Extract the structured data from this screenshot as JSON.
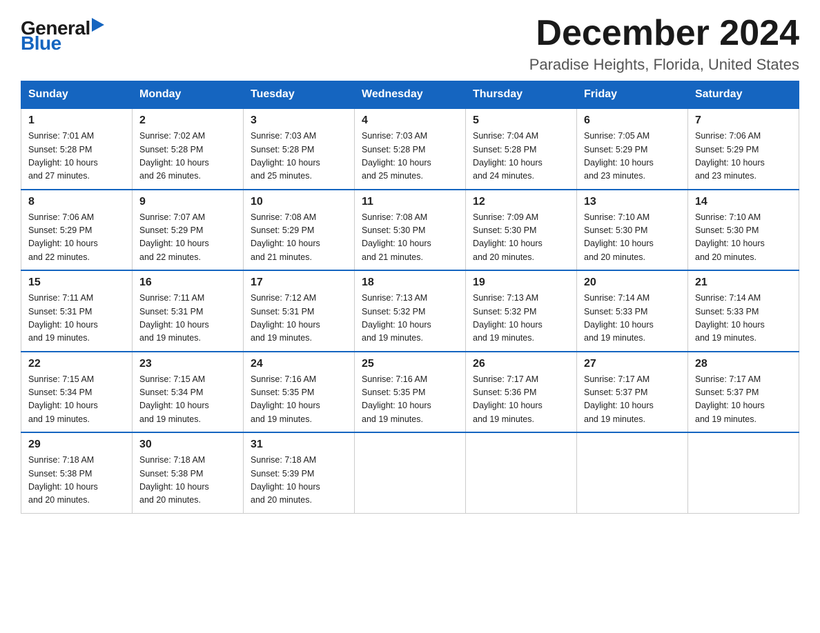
{
  "logo": {
    "general": "General",
    "blue": "Blue"
  },
  "title": {
    "month": "December 2024",
    "location": "Paradise Heights, Florida, United States"
  },
  "weekdays": [
    "Sunday",
    "Monday",
    "Tuesday",
    "Wednesday",
    "Thursday",
    "Friday",
    "Saturday"
  ],
  "weeks": [
    [
      {
        "day": "1",
        "sunrise": "7:01 AM",
        "sunset": "5:28 PM",
        "daylight": "10 hours and 27 minutes."
      },
      {
        "day": "2",
        "sunrise": "7:02 AM",
        "sunset": "5:28 PM",
        "daylight": "10 hours and 26 minutes."
      },
      {
        "day": "3",
        "sunrise": "7:03 AM",
        "sunset": "5:28 PM",
        "daylight": "10 hours and 25 minutes."
      },
      {
        "day": "4",
        "sunrise": "7:03 AM",
        "sunset": "5:28 PM",
        "daylight": "10 hours and 25 minutes."
      },
      {
        "day": "5",
        "sunrise": "7:04 AM",
        "sunset": "5:28 PM",
        "daylight": "10 hours and 24 minutes."
      },
      {
        "day": "6",
        "sunrise": "7:05 AM",
        "sunset": "5:29 PM",
        "daylight": "10 hours and 23 minutes."
      },
      {
        "day": "7",
        "sunrise": "7:06 AM",
        "sunset": "5:29 PM",
        "daylight": "10 hours and 23 minutes."
      }
    ],
    [
      {
        "day": "8",
        "sunrise": "7:06 AM",
        "sunset": "5:29 PM",
        "daylight": "10 hours and 22 minutes."
      },
      {
        "day": "9",
        "sunrise": "7:07 AM",
        "sunset": "5:29 PM",
        "daylight": "10 hours and 22 minutes."
      },
      {
        "day": "10",
        "sunrise": "7:08 AM",
        "sunset": "5:29 PM",
        "daylight": "10 hours and 21 minutes."
      },
      {
        "day": "11",
        "sunrise": "7:08 AM",
        "sunset": "5:30 PM",
        "daylight": "10 hours and 21 minutes."
      },
      {
        "day": "12",
        "sunrise": "7:09 AM",
        "sunset": "5:30 PM",
        "daylight": "10 hours and 20 minutes."
      },
      {
        "day": "13",
        "sunrise": "7:10 AM",
        "sunset": "5:30 PM",
        "daylight": "10 hours and 20 minutes."
      },
      {
        "day": "14",
        "sunrise": "7:10 AM",
        "sunset": "5:30 PM",
        "daylight": "10 hours and 20 minutes."
      }
    ],
    [
      {
        "day": "15",
        "sunrise": "7:11 AM",
        "sunset": "5:31 PM",
        "daylight": "10 hours and 19 minutes."
      },
      {
        "day": "16",
        "sunrise": "7:11 AM",
        "sunset": "5:31 PM",
        "daylight": "10 hours and 19 minutes."
      },
      {
        "day": "17",
        "sunrise": "7:12 AM",
        "sunset": "5:31 PM",
        "daylight": "10 hours and 19 minutes."
      },
      {
        "day": "18",
        "sunrise": "7:13 AM",
        "sunset": "5:32 PM",
        "daylight": "10 hours and 19 minutes."
      },
      {
        "day": "19",
        "sunrise": "7:13 AM",
        "sunset": "5:32 PM",
        "daylight": "10 hours and 19 minutes."
      },
      {
        "day": "20",
        "sunrise": "7:14 AM",
        "sunset": "5:33 PM",
        "daylight": "10 hours and 19 minutes."
      },
      {
        "day": "21",
        "sunrise": "7:14 AM",
        "sunset": "5:33 PM",
        "daylight": "10 hours and 19 minutes."
      }
    ],
    [
      {
        "day": "22",
        "sunrise": "7:15 AM",
        "sunset": "5:34 PM",
        "daylight": "10 hours and 19 minutes."
      },
      {
        "day": "23",
        "sunrise": "7:15 AM",
        "sunset": "5:34 PM",
        "daylight": "10 hours and 19 minutes."
      },
      {
        "day": "24",
        "sunrise": "7:16 AM",
        "sunset": "5:35 PM",
        "daylight": "10 hours and 19 minutes."
      },
      {
        "day": "25",
        "sunrise": "7:16 AM",
        "sunset": "5:35 PM",
        "daylight": "10 hours and 19 minutes."
      },
      {
        "day": "26",
        "sunrise": "7:17 AM",
        "sunset": "5:36 PM",
        "daylight": "10 hours and 19 minutes."
      },
      {
        "day": "27",
        "sunrise": "7:17 AM",
        "sunset": "5:37 PM",
        "daylight": "10 hours and 19 minutes."
      },
      {
        "day": "28",
        "sunrise": "7:17 AM",
        "sunset": "5:37 PM",
        "daylight": "10 hours and 19 minutes."
      }
    ],
    [
      {
        "day": "29",
        "sunrise": "7:18 AM",
        "sunset": "5:38 PM",
        "daylight": "10 hours and 20 minutes."
      },
      {
        "day": "30",
        "sunrise": "7:18 AM",
        "sunset": "5:38 PM",
        "daylight": "10 hours and 20 minutes."
      },
      {
        "day": "31",
        "sunrise": "7:18 AM",
        "sunset": "5:39 PM",
        "daylight": "10 hours and 20 minutes."
      },
      null,
      null,
      null,
      null
    ]
  ],
  "labels": {
    "sunrise": "Sunrise:",
    "sunset": "Sunset:",
    "daylight": "Daylight:"
  }
}
